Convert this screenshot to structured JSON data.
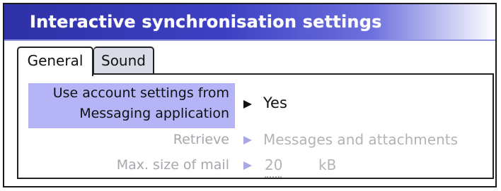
{
  "window": {
    "title": "Interactive synchronisation settings"
  },
  "tabs": [
    {
      "label": "General",
      "selected": true
    },
    {
      "label": "Sound",
      "selected": false
    }
  ],
  "settings": [
    {
      "label_line1": "Use account settings from",
      "label_line2": "Messaging application",
      "value": "Yes",
      "enabled": true,
      "highlighted": true
    },
    {
      "label": "Retrieve",
      "value": "Messages and attachments",
      "enabled": false
    },
    {
      "label": "Max. size of mail",
      "value": "20",
      "unit": "kB",
      "enabled": false
    }
  ],
  "colors": {
    "title_bar": "#3d40c3",
    "highlight": "#b4b4f6",
    "disabled_text": "#a6a6ad"
  }
}
